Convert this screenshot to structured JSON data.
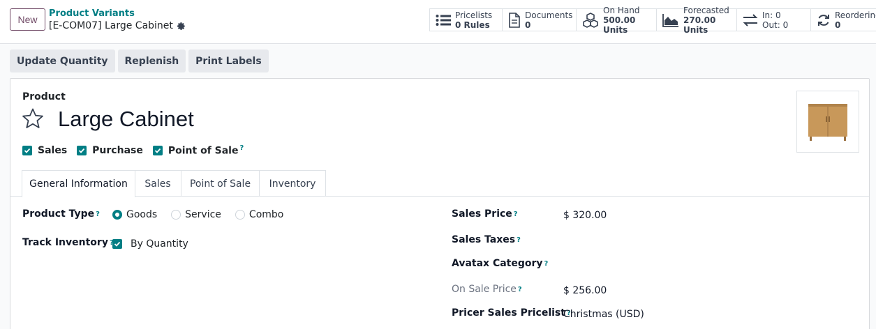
{
  "control_panel": {
    "new_label": "New",
    "breadcrumb_parent": "Product Variants",
    "breadcrumb_current": "[E-COM07] Large Cabinet",
    "stats": [
      {
        "label": "Pricelists",
        "value": "0 Rules",
        "icon": "list-icon"
      },
      {
        "label": "Documents",
        "value": "0",
        "icon": "document-icon"
      },
      {
        "label": "On Hand",
        "value": "500.00 Units",
        "icon": "cubes-icon"
      },
      {
        "label": "Forecasted",
        "value": "270.00 Units",
        "icon": "area-chart-icon"
      },
      {
        "label": "In: 0",
        "value": "Out: 0",
        "icon": "exchange-icon"
      },
      {
        "label": "Reordering",
        "value": "0",
        "icon": "refresh-icon"
      }
    ]
  },
  "actions": {
    "update_quantity": "Update Quantity",
    "replenish": "Replenish",
    "print_labels": "Print Labels"
  },
  "form": {
    "product_label": "Product",
    "name": "Large Cabinet",
    "checks": {
      "sales": "Sales",
      "purchase": "Purchase",
      "pos": "Point of Sale",
      "pos_help": "?"
    },
    "tabs": [
      "General Information",
      "Sales",
      "Point of Sale",
      "Inventory"
    ],
    "left": {
      "product_type_label": "Product Type",
      "product_type_options": [
        "Goods",
        "Service",
        "Combo"
      ],
      "product_type_selected": "Goods",
      "track_inventory_label": "Track Inventory",
      "track_inventory_value": "By Quantity"
    },
    "right": {
      "sales_price_label": "Sales Price",
      "sales_price_value": "$ 320.00",
      "sales_taxes_label": "Sales Taxes",
      "avatax_label": "Avatax Category",
      "on_sale_label": "On Sale Price",
      "on_sale_value": "$ 256.00",
      "pricelist_label": "Pricer Sales Pricelist",
      "pricelist_value": "Christmas (USD)"
    },
    "help_mark": "?"
  },
  "colors": {
    "brand": "#714b67",
    "accent": "#017e84"
  }
}
